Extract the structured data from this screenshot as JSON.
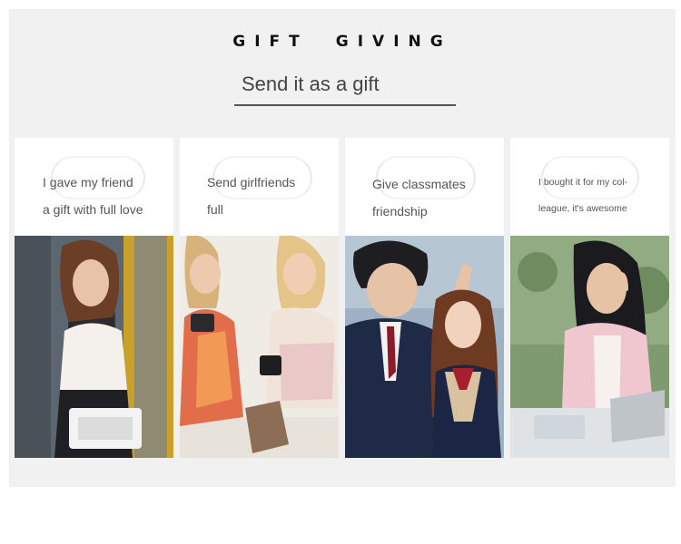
{
  "header": {
    "eyebrow_word1": "GIFT",
    "eyebrow_word2": "GIVING",
    "subtitle": "Send it as a gift"
  },
  "cards": [
    {
      "caption_line1": "I gave my friend",
      "caption_line2": "a gift with full love",
      "photo": "woman-holding-white-clutch-photo"
    },
    {
      "caption_line1": "Send girlfriends",
      "caption_line2": "full",
      "photo": "two-girlfriends-with-mugs-photo"
    },
    {
      "caption_line1": "Give classmates",
      "caption_line2": "friendship",
      "photo": "two-classmates-in-uniform-photo"
    },
    {
      "caption_line1": "I bought it for my col-",
      "caption_line2": "league, it's awesome",
      "photo": "woman-on-phone-at-laptop-photo"
    }
  ],
  "colors": {
    "panel_bg": "#f1f1f1",
    "card_bg": "#ffffff",
    "text": "#555555",
    "heading": "#111111"
  }
}
